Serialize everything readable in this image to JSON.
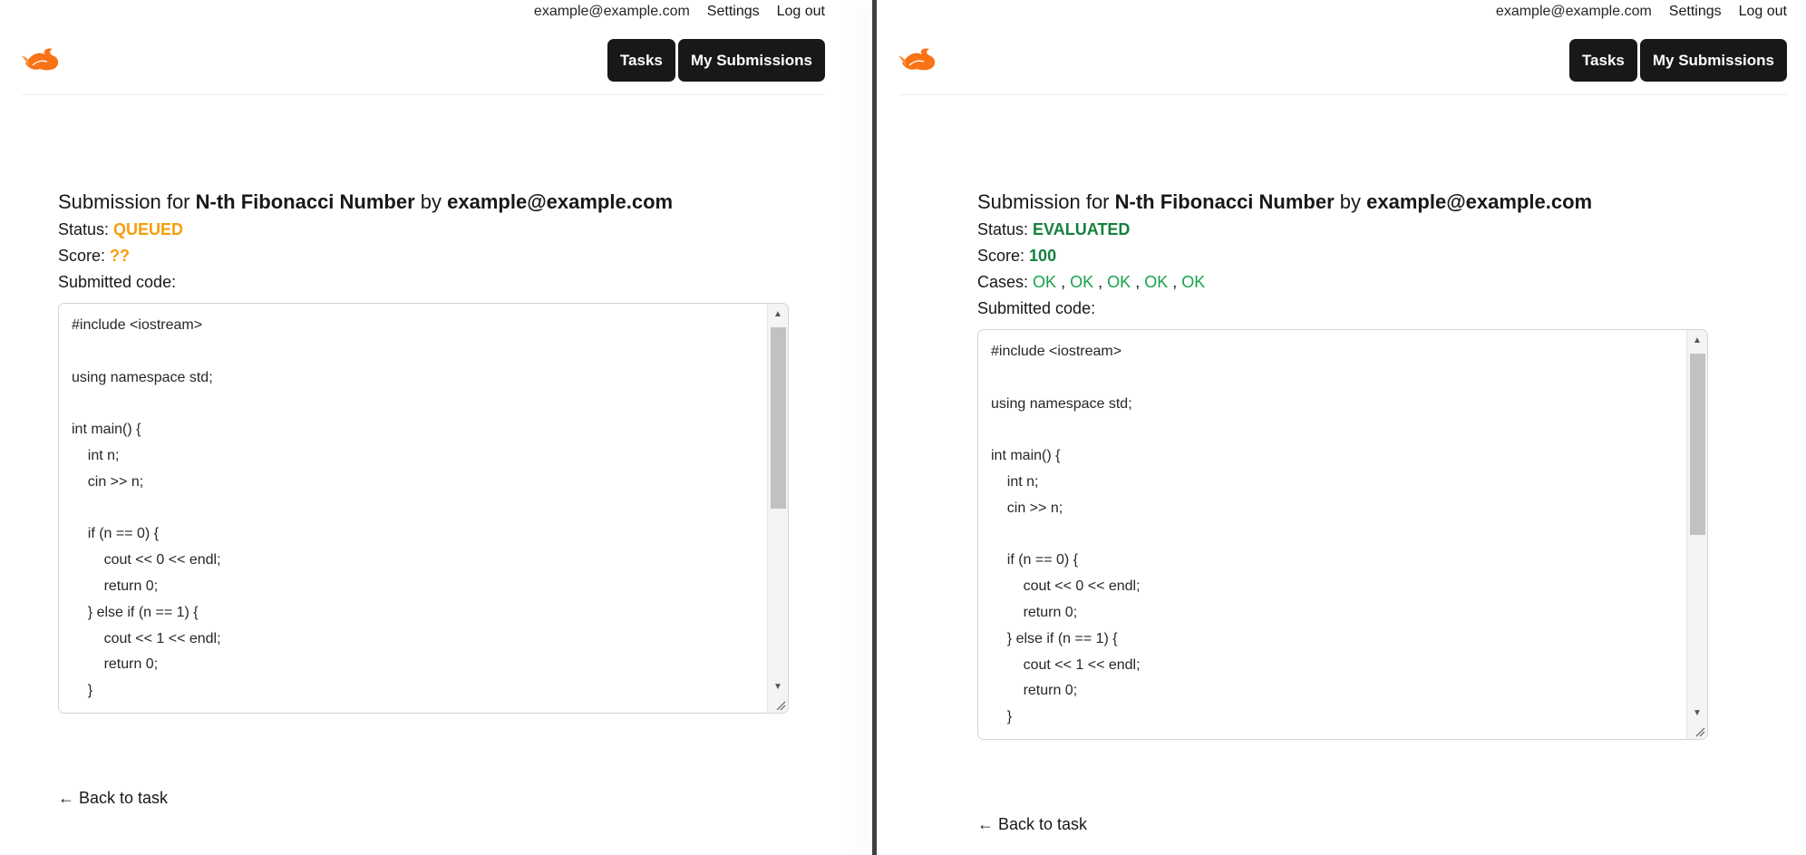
{
  "colors": {
    "accent_dark": "#18181b",
    "queued": "#f59e0b",
    "evaluated": "#15803d",
    "ok": "#16a34a",
    "logo": "#f97316"
  },
  "header": {
    "user_email": "example@example.com",
    "settings_label": "Settings",
    "logout_label": "Log out",
    "nav": {
      "tasks_label": "Tasks",
      "my_submissions_label": "My Submissions"
    },
    "logo_icon": "phoenix-logo-icon"
  },
  "left": {
    "title_prefix": "Submission for",
    "task_name": "N-th Fibonacci Number",
    "title_by": "by",
    "author": "example@example.com",
    "status_label": "Status:",
    "status_value": "QUEUED",
    "score_label": "Score:",
    "score_value": "??",
    "code_label": "Submitted code:",
    "code": "#include <iostream>\n\nusing namespace std;\n\nint main() {\n    int n;\n    cin >> n;\n\n    if (n == 0) {\n        cout << 0 << endl;\n        return 0;\n    } else if (n == 1) {\n        cout << 1 << endl;\n        return 0;\n    }",
    "back_label": "← Back to task"
  },
  "right": {
    "title_prefix": "Submission for",
    "task_name": "N-th Fibonacci Number",
    "title_by": "by",
    "author": "example@example.com",
    "status_label": "Status:",
    "status_value": "EVALUATED",
    "score_label": "Score:",
    "score_value": "100",
    "cases_label": "Cases:",
    "cases": [
      "OK",
      "OK",
      "OK",
      "OK",
      "OK"
    ],
    "case_separator": ",",
    "code_label": "Submitted code:",
    "code": "#include <iostream>\n\nusing namespace std;\n\nint main() {\n    int n;\n    cin >> n;\n\n    if (n == 0) {\n        cout << 0 << endl;\n        return 0;\n    } else if (n == 1) {\n        cout << 1 << endl;\n        return 0;\n    }",
    "back_label": "← Back to task"
  }
}
